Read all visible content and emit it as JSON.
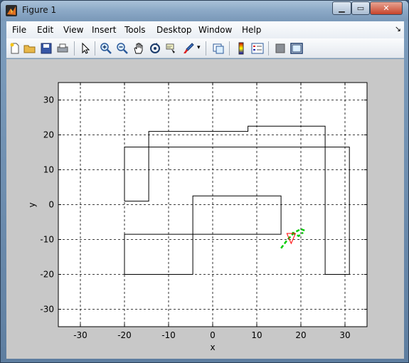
{
  "window": {
    "title": "Figure 1"
  },
  "title_buttons": {
    "minimize": "▁",
    "maximize": "▭",
    "close": "✕"
  },
  "menu": {
    "items": [
      "File",
      "Edit",
      "View",
      "Insert",
      "Tools",
      "Desktop",
      "Window",
      "Help"
    ]
  },
  "toolbar": {
    "icons": [
      "new-figure-icon",
      "open-file-icon",
      "save-icon",
      "print-icon",
      "edit-plot-arrow-icon",
      "zoom-in-icon",
      "zoom-out-icon",
      "pan-hand-icon",
      "rotate-3d-icon",
      "data-cursor-icon",
      "brush-icon",
      "brush-dropdown-icon",
      "link-plot-icon",
      "colorbar-icon",
      "legend-icon",
      "hide-plot-tools-icon",
      "show-plot-tools-icon"
    ]
  },
  "chart_data": {
    "type": "line",
    "xlabel": "x",
    "ylabel": "y",
    "xlim": [
      -35,
      35
    ],
    "ylim": [
      -35,
      35
    ],
    "xticks": [
      -30,
      -20,
      -10,
      0,
      10,
      20,
      30
    ],
    "yticks": [
      -30,
      -20,
      -10,
      0,
      10,
      20,
      30
    ],
    "grid": true,
    "series": [
      {
        "color": "#000000",
        "points": [
          [
            -20,
            1
          ],
          [
            -14.5,
            1
          ],
          [
            -14.5,
            21
          ],
          [
            8,
            21
          ],
          [
            8,
            22.5
          ],
          [
            25.5,
            22.5
          ],
          [
            25.5,
            -20
          ],
          [
            31,
            -20
          ],
          [
            31,
            16.5
          ],
          [
            -20,
            16.5
          ],
          [
            -20,
            1
          ]
        ]
      },
      {
        "color": "#000000",
        "points": [
          [
            -20,
            -20
          ],
          [
            -4.5,
            -20
          ],
          [
            -4.5,
            2.5
          ],
          [
            15.5,
            2.5
          ],
          [
            15.5,
            -8.5
          ],
          [
            -20,
            -8.5
          ],
          [
            -20,
            -20
          ]
        ]
      },
      {
        "color": "#00cc00",
        "style": "dashed",
        "points": [
          [
            15.5,
            -12.5
          ],
          [
            17,
            -10
          ],
          [
            18.5,
            -8
          ],
          [
            20,
            -7
          ],
          [
            21,
            -7.5
          ]
        ]
      },
      {
        "color": "#00cc00",
        "style": "dashed",
        "points": [
          [
            18,
            -8
          ],
          [
            19.5,
            -9
          ],
          [
            20.5,
            -8
          ]
        ]
      }
    ],
    "markers": [
      {
        "type": "triangle-down",
        "color": "#ff0000",
        "x": 17.8,
        "y": -9.5
      }
    ]
  }
}
